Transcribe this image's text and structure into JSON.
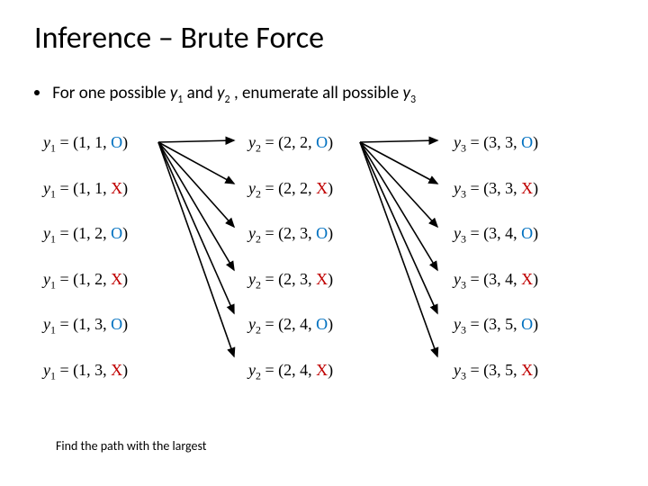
{
  "title": "Inference – Brute Force",
  "bullet": {
    "prefix": "For one possible ",
    "y1": "y",
    "y1sub": "1",
    "mid1": " and ",
    "y2": "y",
    "y2sub": "2",
    "suffix": " , enumerate all possible ",
    "y3": "y",
    "y3sub": "3"
  },
  "columns": [
    {
      "name": "col-y1",
      "var": "y",
      "sub": "1",
      "tuples": [
        "(1, 1, ",
        "(1, 1, ",
        "(1, 2, ",
        "(1, 2, ",
        "(1, 3, ",
        "(1, 3, "
      ],
      "terminals": [
        "O",
        "X",
        "O",
        "X",
        "O",
        "X"
      ]
    },
    {
      "name": "col-y2",
      "var": "y",
      "sub": "2",
      "tuples": [
        "(2, 2, ",
        "(2, 2, ",
        "(2, 3, ",
        "(2, 3, ",
        "(2, 4, ",
        "(2, 4, "
      ],
      "terminals": [
        "O",
        "X",
        "O",
        "X",
        "O",
        "X"
      ]
    },
    {
      "name": "col-y3",
      "var": "y",
      "sub": "3",
      "tuples": [
        "(3, 3, ",
        "(3, 3, ",
        "(3, 4, ",
        "(3, 4, ",
        "(3, 5, ",
        "(3, 5, "
      ],
      "terminals": [
        "O",
        "X",
        "O",
        "X",
        "O",
        "X"
      ]
    }
  ],
  "footer": "Find the path with the largest"
}
